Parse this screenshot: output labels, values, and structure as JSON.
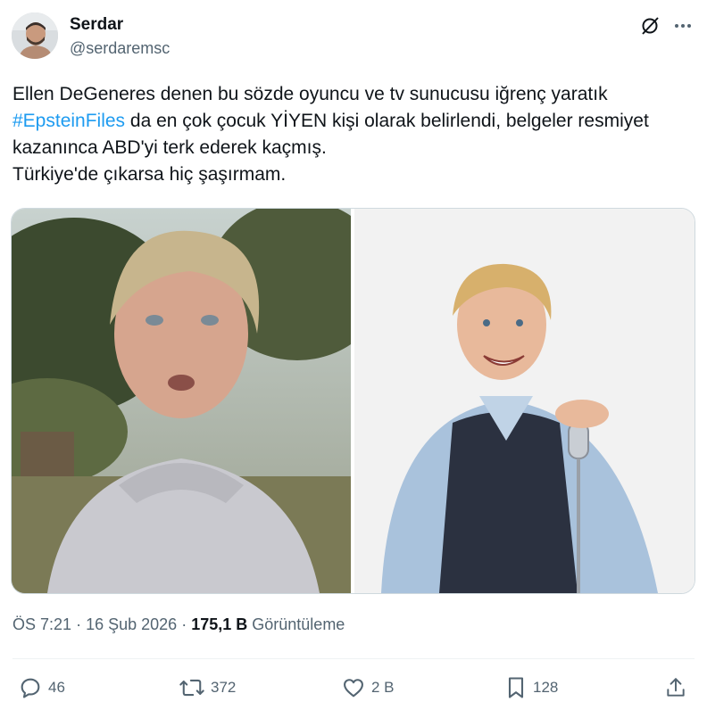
{
  "author": {
    "display_name": "Serdar",
    "handle": "@serdaremsc"
  },
  "tweet": {
    "text_before_hashtag": "Ellen DeGeneres denen bu sözde oyuncu ve tv sunucusu iğrenç yaratık ",
    "hashtag": "#EpsteinFiles",
    "text_after_hashtag": " da en çok çocuk YİYEN kişi olarak belirlendi, belgeler resmiyet kazanınca ABD'yi terk ederek kaçmış.",
    "last_line": "Türkiye'de çıkarsa hiç şaşırmam."
  },
  "meta": {
    "time": "ÖS 7:21",
    "separator": "·",
    "date": "16 Şub 2026",
    "views_count": "175,1 B",
    "views_label": "Görüntüleme"
  },
  "actions": {
    "reply_count": "46",
    "retweet_count": "372",
    "like_count": "2 B",
    "bookmark_count": "128"
  },
  "icons": {
    "header": [
      "grok-icon",
      "more-icon"
    ],
    "actions": [
      "reply-icon",
      "retweet-icon",
      "like-icon",
      "bookmark-icon",
      "share-icon"
    ]
  },
  "colors": {
    "link": "#1d9bf0",
    "secondary_text": "#536471",
    "primary_text": "#0f1419"
  }
}
